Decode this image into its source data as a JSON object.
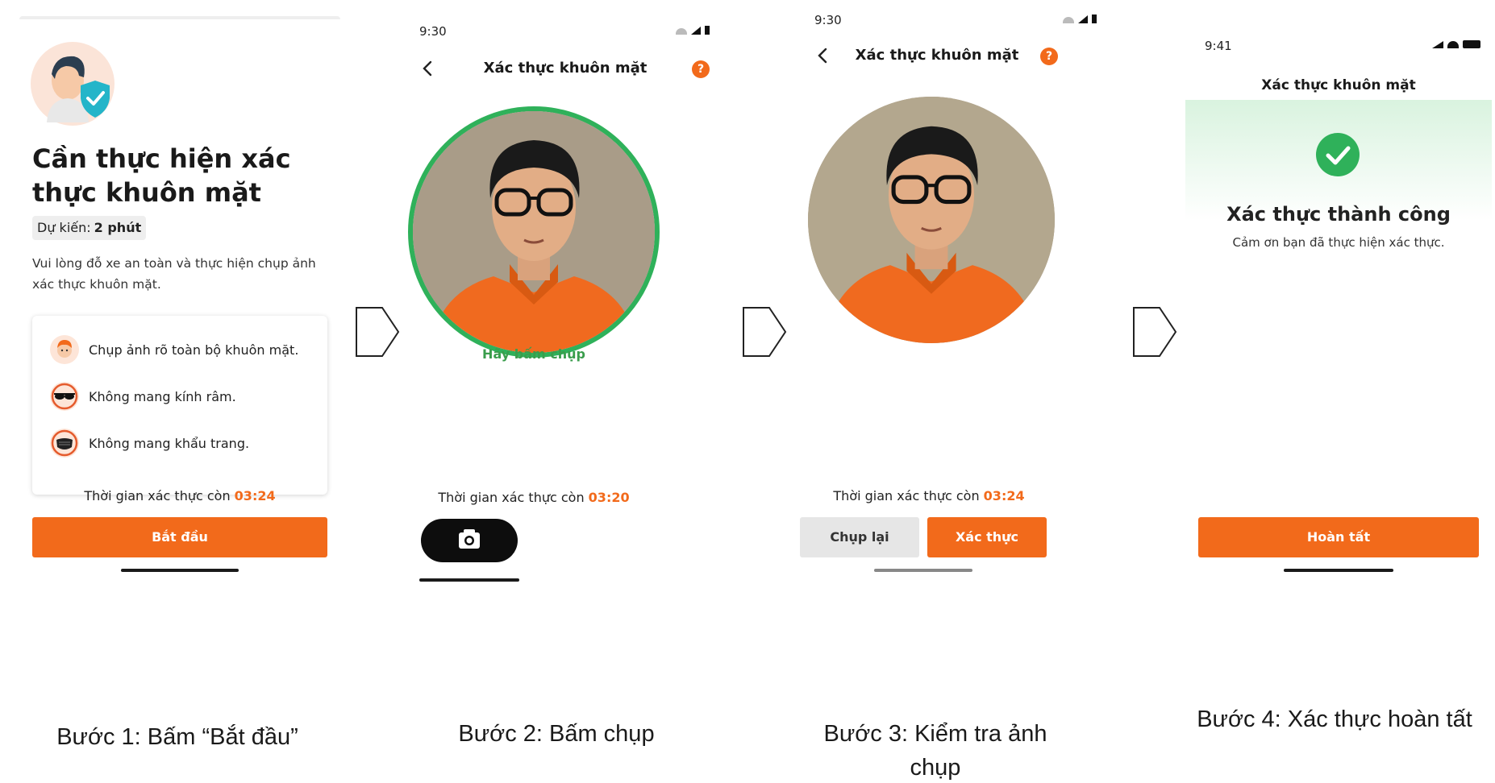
{
  "screen1": {
    "title": "Cần thực hiện xác thực khuôn mặt",
    "estimate_label": "Dự kiến:",
    "estimate_value": "2 phút",
    "description": "Vui lòng đỗ xe an toàn và thực hiện chụp ảnh xác thực khuôn mặt.",
    "rules": [
      {
        "icon": "face-icon",
        "text": "Chụp ảnh rõ toàn bộ khuôn mặt."
      },
      {
        "icon": "sunglasses-icon",
        "text": "Không mang kính râm."
      },
      {
        "icon": "mask-icon",
        "text": "Không mang khẩu trang."
      }
    ],
    "timer_label": "Thời gian xác thực còn",
    "timer_value": "03:24",
    "start_button": "Bắt đầu"
  },
  "screen2": {
    "status_time": "9:30",
    "nav_title": "Xác thực khuôn mặt",
    "hint": "Hãy bấm chụp",
    "timer_label": "Thời gian xác thực còn",
    "timer_value": "03:20",
    "shutter_icon": "camera-icon"
  },
  "screen3": {
    "status_time": "9:30",
    "nav_title": "Xác thực khuôn mặt",
    "timer_label": "Thời gian xác thực còn",
    "timer_value": "03:24",
    "retake_button": "Chụp lại",
    "verify_button": "Xác thực"
  },
  "screen4": {
    "status_time": "9:41",
    "nav_title": "Xác thực khuôn mặt",
    "success_title": "Xác thực thành công",
    "success_sub": "Cảm ơn bạn đã thực hiện xác thực.",
    "done_button": "Hoàn tất"
  },
  "captions": {
    "step1": "Bước 1: Bấm “Bắt đầu”",
    "step2": "Bước 2: Bấm chụp",
    "step3": "Bước 3: Kiểm tra ảnh chụp",
    "step4": "Bước 4: Xác thực hoàn tất"
  },
  "colors": {
    "accent": "#f26a1b",
    "success": "#2fb15a",
    "hint": "#3a9d4c",
    "secondary_button": "#e6e6e6"
  }
}
